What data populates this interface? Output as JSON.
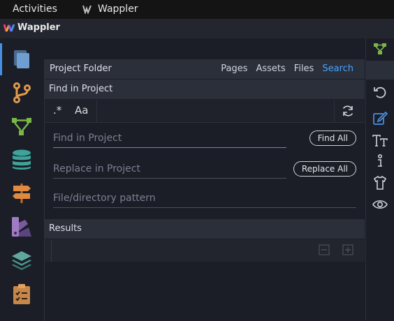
{
  "system": {
    "activities": "Activities",
    "app_name": "Wappler"
  },
  "window": {
    "brand": "Wappler"
  },
  "panel": {
    "title": "Project Folder",
    "tabs": [
      "Pages",
      "Assets",
      "Files",
      "Search"
    ],
    "active_tab": "Search"
  },
  "find": {
    "section_title": "Find in Project",
    "regex_toggle": ".*",
    "case_toggle": "Aa",
    "find_placeholder": "Find in Project",
    "find_all_label": "Find All",
    "replace_placeholder": "Replace in Project",
    "replace_all_label": "Replace All",
    "pattern_placeholder": "File/directory pattern"
  },
  "results": {
    "section_title": "Results"
  },
  "icons": {
    "left": [
      "files-icon",
      "git-branch-icon",
      "app-structure-icon",
      "database-icon",
      "routing-signpost-icon",
      "design-palette-icon",
      "layers-icon",
      "tasks-clipboard-icon"
    ],
    "right": [
      "structure-tree-icon",
      "undo-icon",
      "edit-pencil-icon",
      "text-typography-icon",
      "info-icon",
      "attribute-shirt-icon",
      "eye-icon"
    ]
  },
  "colors": {
    "accent": "#4a90e2",
    "active_tab": "#4aa3ff",
    "background": "#1b1e27",
    "header": "#2b2f3a"
  }
}
